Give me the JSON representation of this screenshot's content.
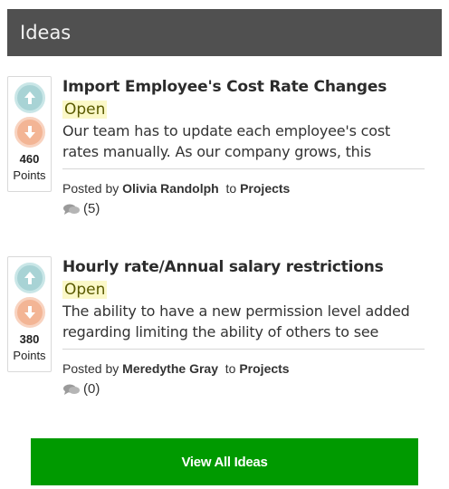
{
  "header": {
    "title": "Ideas"
  },
  "ideas": [
    {
      "points": "460",
      "points_label": "Points",
      "title": "Import Employee's Cost Rate Changes",
      "status": "Open",
      "description": "Our team has to update each employee's cost rates manually. As our company grows, this",
      "posted_by_prefix": "Posted by",
      "author": "Olivia Randolph",
      "to_text": "to",
      "category": "Projects",
      "comment_count": "(5)"
    },
    {
      "points": "380",
      "points_label": "Points",
      "title": "Hourly rate/Annual salary restrictions",
      "status": "Open",
      "description": "The ability to have a new permission level added regarding limiting the ability of others to see",
      "posted_by_prefix": "Posted by",
      "author": "Meredythe Gray",
      "to_text": "to",
      "category": "Projects",
      "comment_count": "(0)"
    }
  ],
  "footer": {
    "view_all_label": "View All Ideas"
  },
  "colors": {
    "header_bg": "#505050",
    "upvote": "#a8d3d5",
    "downvote": "#f3b595",
    "status_highlight": "#fbf8c8",
    "button_green": "#009a00"
  },
  "icons": {
    "upvote": "arrow-up-circle-icon",
    "downvote": "arrow-down-circle-icon",
    "comments": "speech-bubbles-icon"
  }
}
